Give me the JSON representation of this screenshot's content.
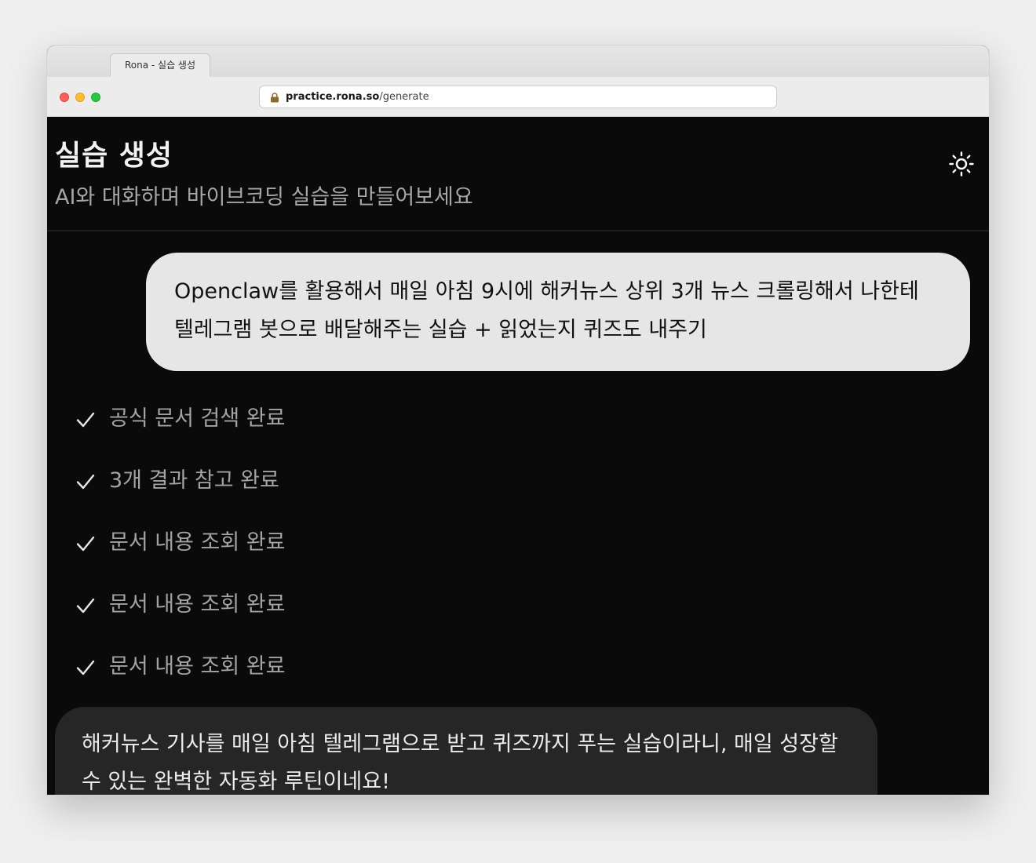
{
  "browser": {
    "tab_title": "Rona - 실습 생성",
    "url_domain": "practice.rona.so",
    "url_path": "/generate"
  },
  "header": {
    "title": "실습 생성",
    "subtitle": "AI와 대화하며 바이브코딩 실습을 만들어보세요",
    "theme_toggle_icon": "sun-icon"
  },
  "chat": {
    "user_message": "Openclaw를 활용해서 매일 아침 9시에 해커뉴스 상위 3개 뉴스 크롤링해서 나한테 텔레그램 봇으로 배달해주는 실습 + 읽었는지 퀴즈도 내주기",
    "steps": [
      {
        "label": "공식 문서 검색 완료",
        "icon": "check-icon"
      },
      {
        "label": "3개 결과 참고 완료",
        "icon": "check-icon"
      },
      {
        "label": "문서 내용 조회 완료",
        "icon": "check-icon"
      },
      {
        "label": "문서 내용 조회 완료",
        "icon": "check-icon"
      },
      {
        "label": "문서 내용 조회 완료",
        "icon": "check-icon"
      }
    ],
    "assistant_message": "해커뉴스 기사를 매일 아침 텔레그램으로 받고 퀴즈까지 푸는 실습이라니, 매일 성장할 수 있는 완벽한 자동화 루틴이네요!"
  },
  "colors": {
    "page_background": "#0a0a0a",
    "user_bubble": "#e6e6e6",
    "assistant_bubble": "#262626",
    "muted_text": "#a3a3a3"
  }
}
